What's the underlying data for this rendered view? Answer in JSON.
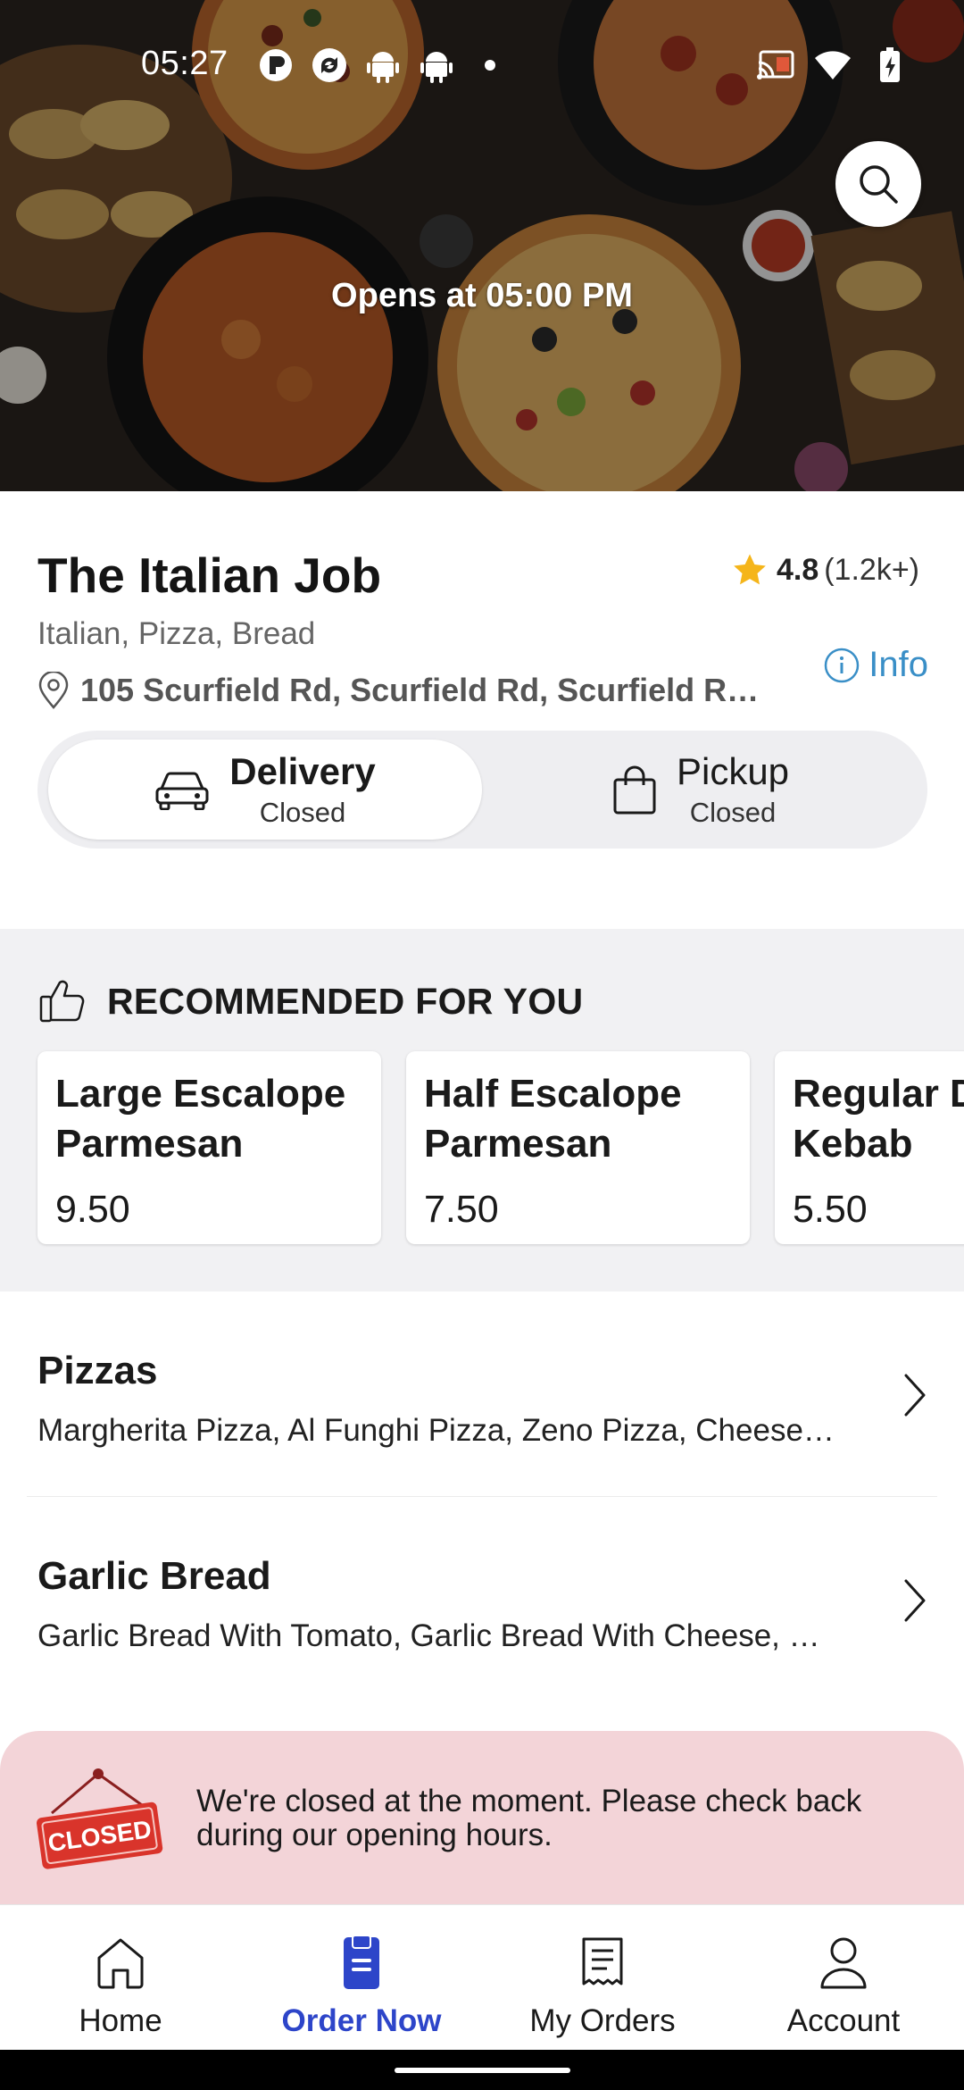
{
  "status_bar": {
    "time": "05:27",
    "left_icons": [
      "app-notification-icon",
      "sync-icon",
      "android-icon",
      "android-icon",
      "dot-icon"
    ],
    "right_icons": [
      "cast-icon",
      "wifi-icon",
      "battery-charging-icon"
    ]
  },
  "hero": {
    "opens_text": "Opens at 05:00 PM",
    "search_icon": "search-icon"
  },
  "restaurant": {
    "name": "The Italian Job",
    "rating_value": "4.8",
    "rating_count": "(1.2k+)",
    "cuisines": "Italian, Pizza, Bread",
    "address": "105 Scurfield Rd, Scurfield Rd, Scurfield Rd, ...",
    "info_label": "Info",
    "star_color": "#f5b51a",
    "info_color": "#3a8fc7"
  },
  "modes": {
    "delivery": {
      "title": "Delivery",
      "status": "Closed",
      "icon": "car-icon"
    },
    "pickup": {
      "title": "Pickup",
      "status": "Closed",
      "icon": "bag-icon"
    }
  },
  "recommended": {
    "title": "RECOMMENDED FOR YOU",
    "icon": "thumbs-up-icon",
    "items": [
      {
        "name": "Large Escalope\nParmesan",
        "price": "9.50"
      },
      {
        "name": "Half Escalope\nParmesan",
        "price": "7.50"
      },
      {
        "name": "Regular Doner\nKebab",
        "price": "5.50"
      }
    ]
  },
  "categories": [
    {
      "title": "Pizzas",
      "items": "Margherita Pizza, Al Funghi Pizza, Zeno Pizza, Cheese Pizza, ..."
    },
    {
      "title": "Garlic Bread",
      "items": "Garlic Bread With Tomato, Garlic Bread With Cheese, Garlic Bread, ..."
    }
  ],
  "closed_banner": {
    "sign_text": "CLOSED",
    "message": "We're closed at the moment. Please check back during our opening hours.",
    "background": "#f3d4d8"
  },
  "bottom_nav": {
    "items": [
      {
        "label": "Home",
        "icon": "home-icon"
      },
      {
        "label": "Order Now",
        "icon": "order-icon"
      },
      {
        "label": "My Orders",
        "icon": "receipt-icon"
      },
      {
        "label": "Account",
        "icon": "person-icon"
      }
    ],
    "active_color": "#2d45c9"
  }
}
